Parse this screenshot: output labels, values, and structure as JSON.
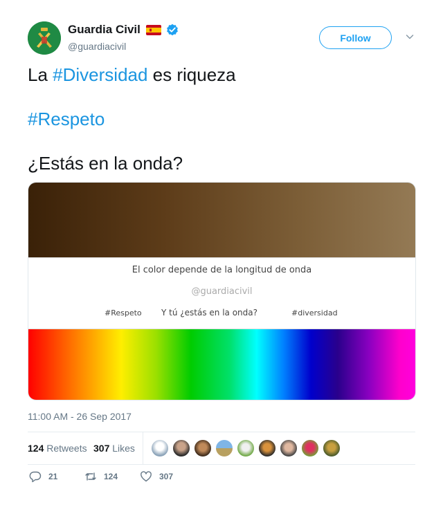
{
  "user": {
    "display_name": "Guardia Civil",
    "handle": "@guardiacivil",
    "flag_icon": "spain-flag-icon",
    "verified_icon": "verified-badge-icon"
  },
  "follow_label": "Follow",
  "tweet": {
    "line1_prefix": "La ",
    "line1_hashtag": "#Diversidad",
    "line1_suffix": " es riqueza",
    "line2_hashtag": "#Respeto",
    "line3": "¿Estás en la onda?"
  },
  "media": {
    "caption_main": "El color depende de la longitud de onda",
    "caption_handle": "@guardiacivil",
    "caption_tag_left": "#Respeto",
    "caption_center": "Y tú ¿estás en la onda?",
    "caption_tag_right": "#diversidad"
  },
  "timestamp": "11:00 AM - 26 Sep 2017",
  "stats": {
    "retweets_count": "124",
    "retweets_label": "Retweets",
    "likes_count": "307",
    "likes_label": "Likes"
  },
  "actions": {
    "reply_count": "21",
    "retweet_count": "124",
    "like_count": "307"
  },
  "colors": {
    "accent": "#1da1f2",
    "hashtag": "#1b95e0",
    "muted": "#657786"
  }
}
